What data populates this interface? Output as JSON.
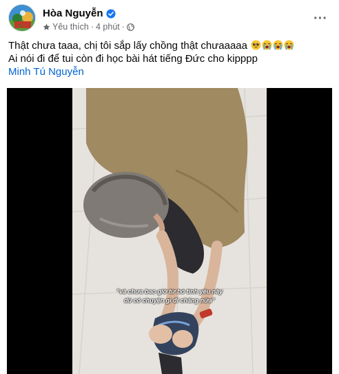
{
  "post": {
    "author": "Hòa Nguyễn",
    "meta_label": "Yêu thích",
    "separator": "·",
    "time": "4 phút",
    "separator2": "·",
    "text_line1": "Thật chưa taaa, chị tôi sắp lấy chồng thật chưaaaaa",
    "text_line2": "Ai nói đi để tui còn đi học bài hát tiếng Đức cho kipppp",
    "mention": "Minh Tú Nguyễn",
    "more_label": "···",
    "emojis": [
      "pleading-face-icon",
      "crying-face-icon",
      "crying-face-icon",
      "crying-face-icon"
    ]
  },
  "video": {
    "subtitle_line1": "\"và chưa bao giờ từ bỏ tình yêu này",
    "subtitle_line2": "dù có chuyện gì đi chăng nữa\""
  },
  "colors": {
    "verified": "#1877f2",
    "link": "#0064d1",
    "meta": "#65676b"
  }
}
